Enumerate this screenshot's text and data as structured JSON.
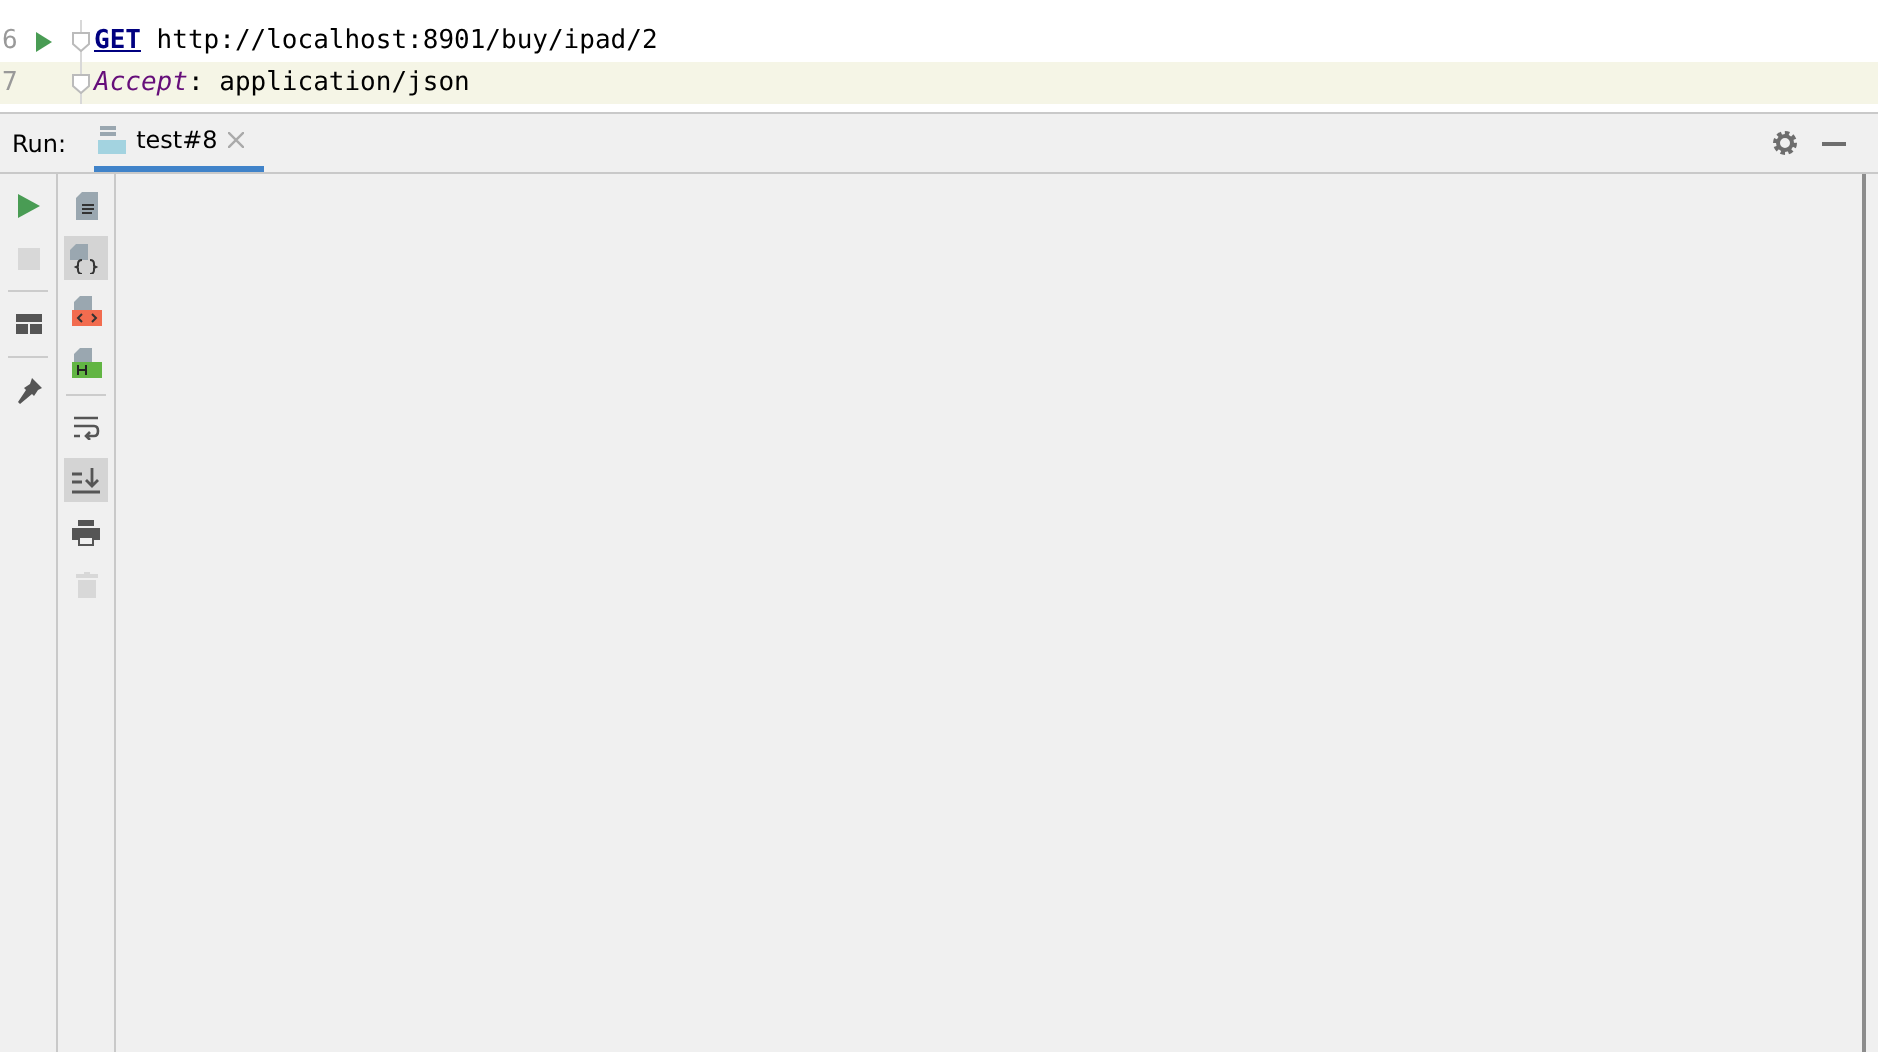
{
  "editor": {
    "lines": [
      {
        "number": "6",
        "tokens": [
          {
            "kind": "method",
            "text": "GET"
          },
          {
            "kind": "plain",
            "text": " http://localhost:8901/buy/ipad/2"
          }
        ],
        "run": true,
        "fold": true,
        "current": false
      },
      {
        "number": "7",
        "tokens": [
          {
            "kind": "header",
            "text": "Accept"
          },
          {
            "kind": "plain",
            "text": ": application/json"
          }
        ],
        "run": false,
        "fold": true,
        "current": true
      }
    ]
  },
  "run_panel": {
    "label": "Run:",
    "tabs": [
      {
        "title": "test#8",
        "selected": true
      }
    ],
    "left_tools": [
      {
        "kind": "run",
        "disabled": false,
        "toggled": false
      },
      {
        "kind": "stop",
        "disabled": true,
        "toggled": false
      },
      {
        "kind": "layout",
        "disabled": false,
        "toggled": false
      },
      {
        "kind": "pin",
        "disabled": false,
        "toggled": false
      }
    ],
    "right_tools": [
      {
        "kind": "text-doc",
        "disabled": false,
        "toggled": false
      },
      {
        "kind": "json-doc",
        "disabled": false,
        "toggled": true
      },
      {
        "kind": "html-doc",
        "disabled": false,
        "toggled": false
      },
      {
        "kind": "h-doc",
        "disabled": false,
        "toggled": false
      },
      {
        "kind": "wrap",
        "disabled": false,
        "toggled": false
      },
      {
        "kind": "scroll-end",
        "disabled": false,
        "toggled": true
      },
      {
        "kind": "print",
        "disabled": false,
        "toggled": false
      },
      {
        "kind": "trash",
        "disabled": true,
        "toggled": false
      }
    ]
  }
}
